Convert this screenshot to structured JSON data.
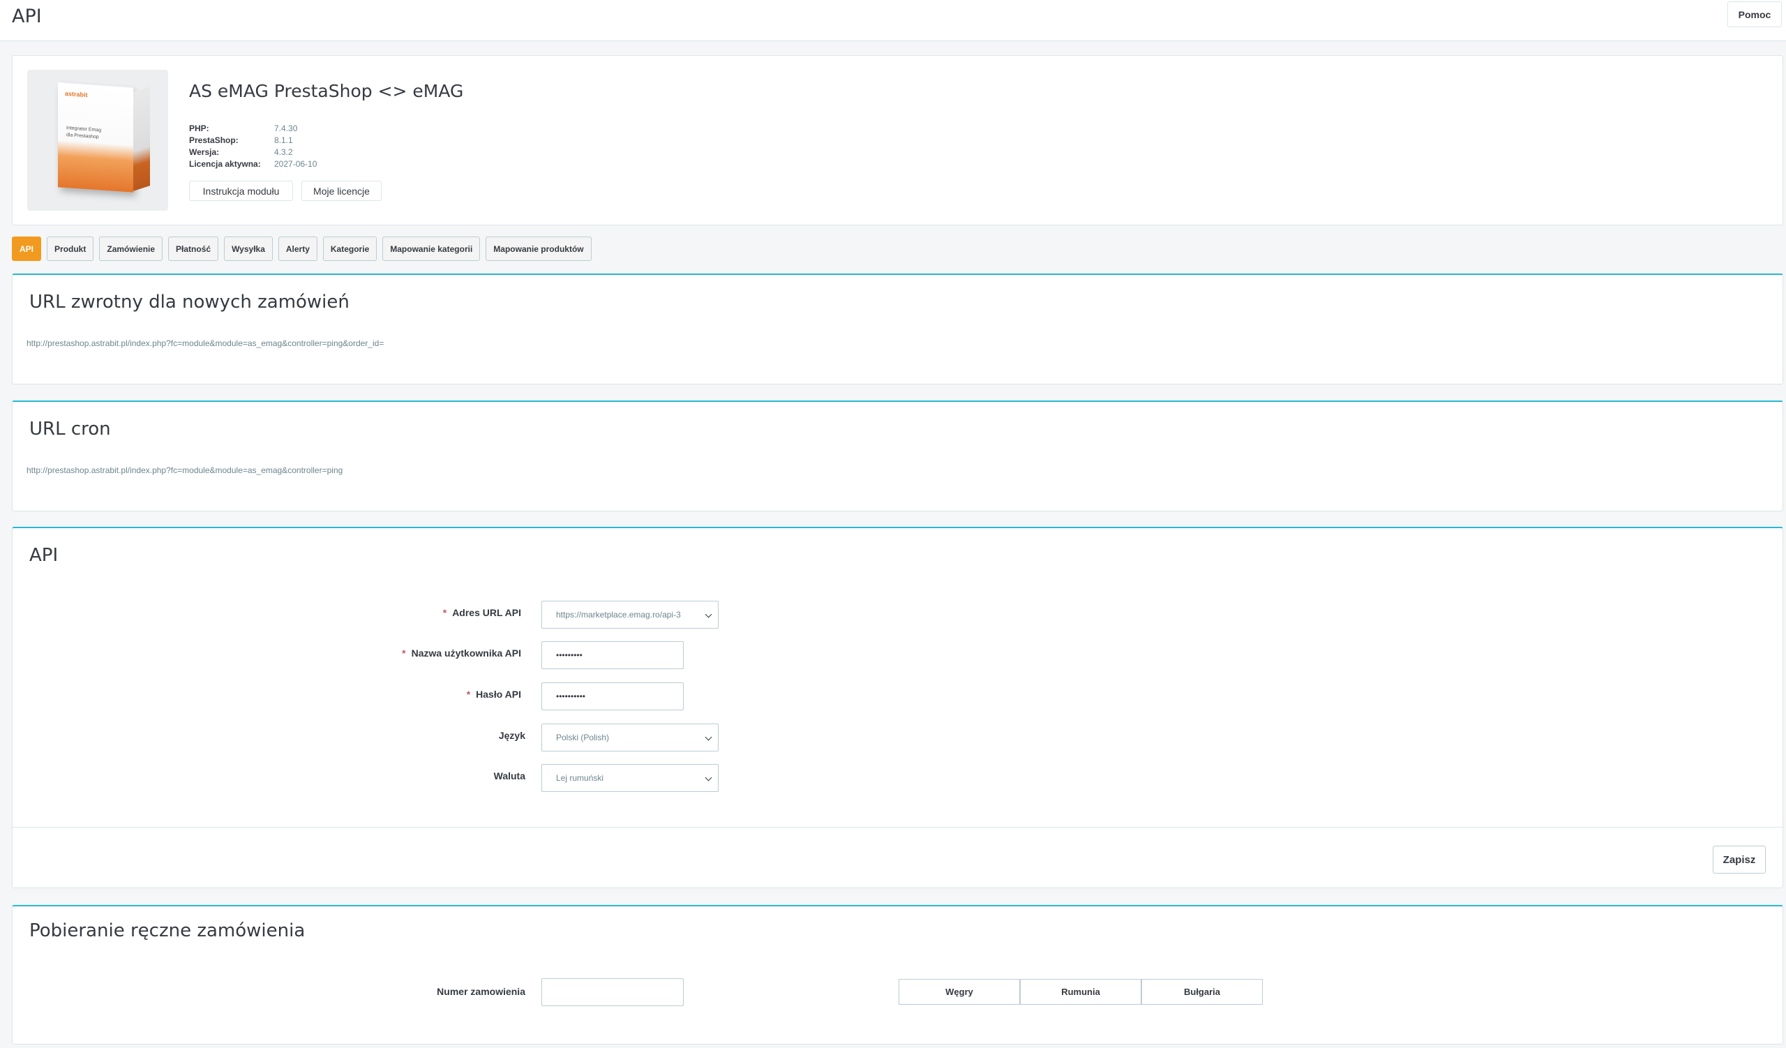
{
  "header": {
    "title": "API",
    "help_label": "Pomoc"
  },
  "module": {
    "name": "AS eMAG PrestaShop <> eMAG",
    "box_brand": "astrabit",
    "box_text_line1": "Integrator Emag",
    "box_text_line2": "dla Prestashop",
    "info": [
      {
        "label": "PHP:",
        "value": "7.4.30"
      },
      {
        "label": "PrestaShop:",
        "value": "8.1.1"
      },
      {
        "label": "Wersja:",
        "value": "4.3.2"
      },
      {
        "label": "Licencja aktywna:",
        "value": "2027-06-10"
      }
    ],
    "instructions_label": "Instrukcja modułu",
    "licenses_label": "Moje licencje"
  },
  "tabs": [
    {
      "label": "API",
      "active": true
    },
    {
      "label": "Produkt"
    },
    {
      "label": "Zamówienie"
    },
    {
      "label": "Płatność"
    },
    {
      "label": "Wysyłka"
    },
    {
      "label": "Alerty"
    },
    {
      "label": "Kategorie"
    },
    {
      "label": "Mapowanie kategorii"
    },
    {
      "label": "Mapowanie produktów"
    }
  ],
  "return_url": {
    "title": "URL zwrotny dla nowych zamówień",
    "url": "http://prestashop.astrabit.pl/index.php?fc=module&module=as_emag&controller=ping&order_id="
  },
  "cron_url": {
    "title": "URL cron",
    "url": "http://prestashop.astrabit.pl/index.php?fc=module&module=as_emag&controller=ping"
  },
  "api": {
    "title": "API",
    "url_label": "Adres URL API",
    "url_value": "https://marketplace.emag.ro/api-3",
    "user_label": "Nazwa użytkownika API",
    "user_value": "•••••••••",
    "password_label": "Hasło API",
    "password_value": "••••••••••",
    "language_label": "Język",
    "language_value": "Polski (Polish)",
    "currency_label": "Waluta",
    "currency_value": "Lej rumuński",
    "save_label": "Zapisz"
  },
  "manual": {
    "title": "Pobieranie ręczne zamówienia",
    "order_label": "Numer zamowienia",
    "order_value": "",
    "countries": [
      "Węgry",
      "Rumunia",
      "Bułgaria"
    ]
  },
  "colors": {
    "accent": "#25b9d7",
    "active_tab": "#f29a1f",
    "required": "#c05c67"
  }
}
